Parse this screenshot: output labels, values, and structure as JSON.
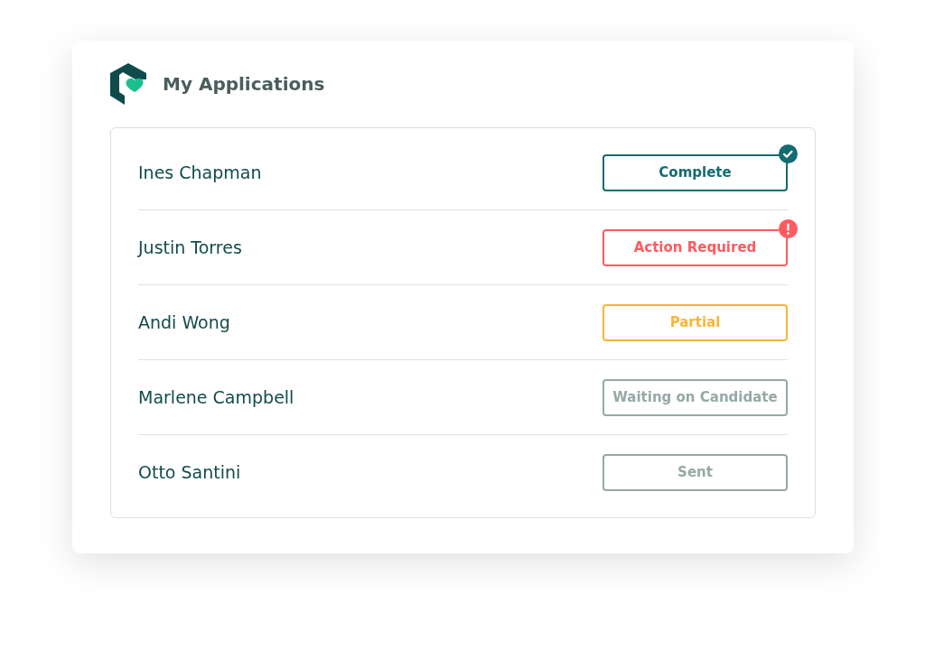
{
  "header": {
    "title": "My Applications"
  },
  "applications": [
    {
      "name": "Ines Chapman",
      "status": {
        "label": "Complete",
        "color": "#136c72",
        "kind": "check"
      }
    },
    {
      "name": "Justin Torres",
      "status": {
        "label": "Action Required",
        "color": "#ff5a5f",
        "kind": "alert"
      }
    },
    {
      "name": "Andi Wong",
      "status": {
        "label": "Partial",
        "color": "#fbb534",
        "kind": "plain"
      }
    },
    {
      "name": "Marlene Campbell",
      "status": {
        "label": "Waiting on Candidate",
        "color": "#95a9a6",
        "kind": "plain"
      }
    },
    {
      "name": "Otto Santini",
      "status": {
        "label": "Sent",
        "color": "#95a9a6",
        "kind": "plain"
      }
    }
  ]
}
